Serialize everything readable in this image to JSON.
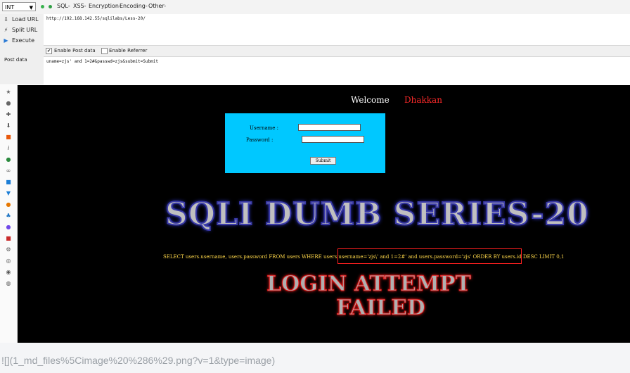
{
  "toolbar": {
    "select_value": "INT",
    "menus": [
      "SQL-",
      "XSS-",
      "Encryption-",
      "Encoding-",
      "Other-"
    ],
    "dot_colors": [
      "#37b24d",
      "#2f9e44"
    ]
  },
  "actions": [
    {
      "label": "Load URL",
      "icon": "load-icon"
    },
    {
      "label": "Split URL",
      "icon": "split-icon"
    },
    {
      "label": "Execute",
      "icon": "play-icon"
    }
  ],
  "url": {
    "value": "http://192.168.142.55/sqlilabs/Less-20/"
  },
  "options": {
    "enable_post": "Enable Post data",
    "enable_referrer": "Enable Referrer",
    "post_checked": "✔"
  },
  "post": {
    "label": "Post data",
    "value": "uname=zjs' and 1=2#&passwd=zjs&submit=Submit"
  },
  "page": {
    "welcome": "Welcome",
    "user": "Dhakkan",
    "username_label": "Username :",
    "password_label": "Password :",
    "submit_label": "Submit",
    "banner": "SQLI DUMB SERIES-20",
    "sql": "SELECT users.username, users.password FROM users WHERE users.username='zjs\\' and 1=2#' and users.password='zjs' ORDER BY users.id DESC LIMIT 0,1",
    "failed_line1": "LOGIN ATTEMPT",
    "failed_line2": "FAILED"
  },
  "caption": "![](1_md_files%5Cimage%20%286%29.png?v=1&type=image)",
  "colors": {
    "form_bg": "#00c8ff",
    "user_color": "#ff2a2a",
    "sql_color": "#ffd84a",
    "highlight_border": "#ff2020"
  }
}
